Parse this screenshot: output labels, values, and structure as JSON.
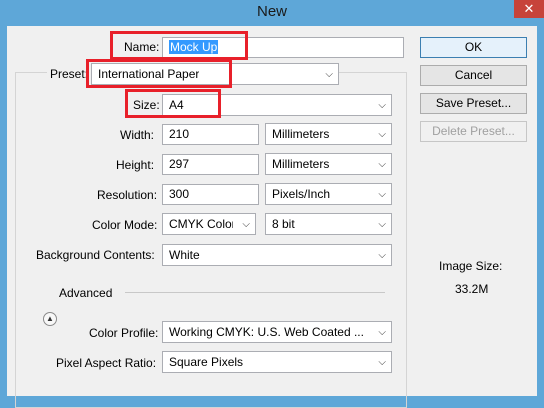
{
  "window": {
    "title": "New",
    "close_glyph": "✕"
  },
  "fields": {
    "name": {
      "label": "Name:",
      "value": "Mock Up"
    },
    "preset": {
      "label": "Preset:",
      "value": "International Paper"
    },
    "size": {
      "label": "Size:",
      "value": "A4"
    },
    "width": {
      "label": "Width:",
      "value": "210",
      "unit": "Millimeters"
    },
    "height": {
      "label": "Height:",
      "value": "297",
      "unit": "Millimeters"
    },
    "resolution": {
      "label": "Resolution:",
      "value": "300",
      "unit": "Pixels/Inch"
    },
    "color_mode": {
      "label": "Color Mode:",
      "value": "CMYK Color",
      "depth": "8 bit"
    },
    "background": {
      "label": "Background Contents:",
      "value": "White"
    },
    "advanced": {
      "label": "Advanced",
      "icon": "collapse-icon"
    },
    "color_profile": {
      "label": "Color Profile:",
      "value": "Working CMYK:  U.S. Web Coated ..."
    },
    "pixel_aspect": {
      "label": "Pixel Aspect Ratio:",
      "value": "Square Pixels"
    }
  },
  "buttons": {
    "ok": "OK",
    "cancel": "Cancel",
    "save_preset": "Save Preset...",
    "delete_preset": "Delete Preset..."
  },
  "image_size": {
    "label": "Image Size:",
    "value": "33.2M"
  },
  "colors": {
    "highlight": "#e8202a",
    "titlebar": "#5ea7d8",
    "dialog_bg": "#f0f0f0"
  }
}
